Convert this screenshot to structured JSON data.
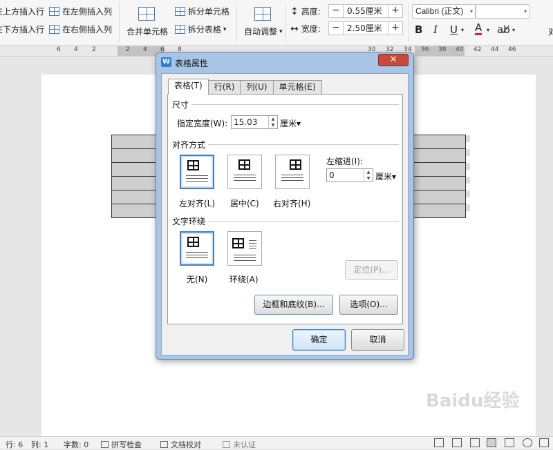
{
  "ribbon": {
    "insert_above": "在上方插入行",
    "insert_below": "在下方插入行",
    "insert_left": "在左侧插入列",
    "insert_right": "在右侧插入列",
    "merge_cells": "合并单元格",
    "split_cells": "拆分单元格",
    "split_table": "拆分表格",
    "auto_fit": "自动调整",
    "height_label": "高度:",
    "height_value": "0.55厘米",
    "width_label": "宽度:",
    "width_value": "2.50厘米",
    "font_name": "Calibri (正文)",
    "bold": "B",
    "italic": "I",
    "underline": "U",
    "font_color": "A",
    "more_glyph": "对"
  },
  "ruler": {
    "ticks": [
      "6",
      "4",
      "2",
      "2",
      "4",
      "6",
      "8",
      "30",
      "32",
      "34",
      "36",
      "38",
      "40",
      "42",
      "44",
      "46"
    ]
  },
  "dialog": {
    "title": "表格属性",
    "app_icon": "W",
    "close": "✕",
    "tabs": [
      {
        "label": "表格(T)",
        "active": true
      },
      {
        "label": "行(R)",
        "active": false
      },
      {
        "label": "列(U)",
        "active": false
      },
      {
        "label": "单元格(E)",
        "active": false
      }
    ],
    "size_group": "尺寸",
    "width_label": "指定宽度(W):",
    "width_value": "15.03",
    "width_unit": "厘米▾",
    "align_group": "对齐方式",
    "align_left": "左对齐(L)",
    "align_center": "居中(C)",
    "align_right": "右对齐(H)",
    "indent_label": "左缩进(I):",
    "indent_value": "0",
    "indent_unit": "厘米▾",
    "wrap_group": "文字环绕",
    "wrap_none": "无(N)",
    "wrap_around": "环绕(A)",
    "position_btn": "定位(P)...",
    "borders_btn": "边框和底纹(B)...",
    "options_btn": "选项(O)...",
    "ok_btn": "确定",
    "cancel_btn": "取消"
  },
  "statusbar": {
    "row": "行: 6",
    "col": "列: 1",
    "chars": "字数: 0",
    "spell": "拼写检查",
    "proof": "文档校对",
    "auth": "未认证"
  },
  "watermark": "Baidu经验"
}
